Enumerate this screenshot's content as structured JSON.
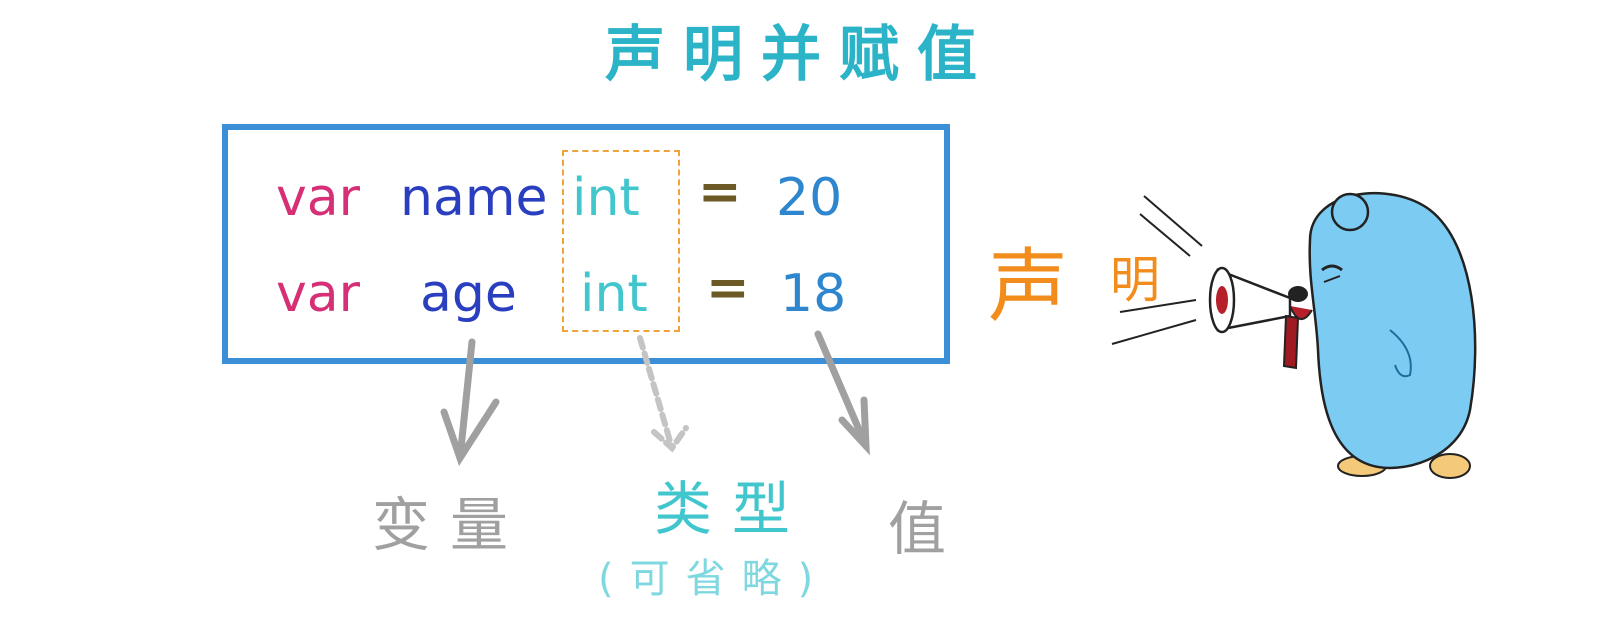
{
  "title": "声明并赋值",
  "rows": [
    {
      "kw": "var",
      "name": "name",
      "type": "int",
      "eq": "=",
      "value": "20"
    },
    {
      "kw": "var",
      "name": "age",
      "type": "int",
      "eq": "=",
      "value": "18"
    }
  ],
  "labels": {
    "variable": "变量",
    "type": "类型",
    "type_note": "(可省略)",
    "value": "值"
  },
  "side_text": {
    "first": "声",
    "second": "明"
  },
  "mascot": "gopher-with-megaphone",
  "colors": {
    "title": "#2bb3c8",
    "box": "#3a8fd6",
    "keyword": "#d62f75",
    "identifier": "#2a3fbf",
    "type": "#40c6cc",
    "type_box": "#f0a33a",
    "equals": "#6b5a26",
    "value": "#2e86cf",
    "gray": "#a0a0a0",
    "orange": "#f28c1c",
    "gopher": "#7ccbf2"
  }
}
